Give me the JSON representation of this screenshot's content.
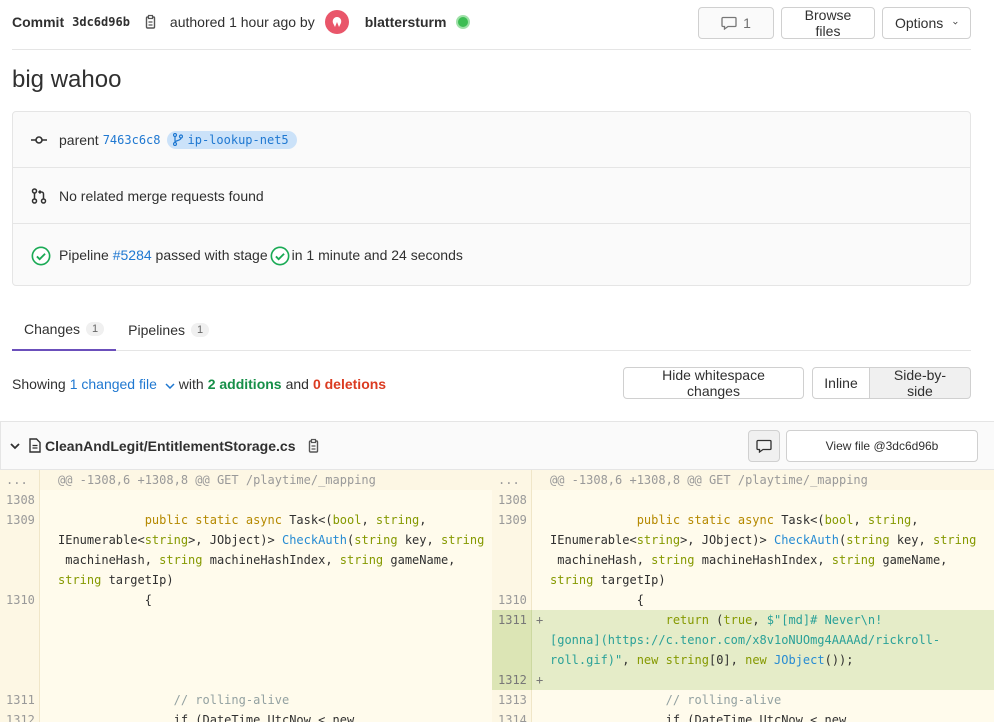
{
  "header": {
    "commit_label": "Commit",
    "sha": "3dc6d96b",
    "authored": "authored 1 hour ago by",
    "author": "blattersturm",
    "comments_count": "1",
    "browse_files": "Browse files",
    "options": "Options"
  },
  "title": "big wahoo",
  "info": {
    "parent_label": "parent",
    "parent_sha": "7463c6c8",
    "branch": "ip-lookup-net5",
    "merge_requests": "No related merge requests found",
    "pipeline_prefix": "Pipeline",
    "pipeline_id": "#5284",
    "pipeline_mid": "passed with stage",
    "pipeline_suffix": "in 1 minute and 24 seconds"
  },
  "tabs": [
    {
      "label": "Changes",
      "count": "1"
    },
    {
      "label": "Pipelines",
      "count": "1"
    }
  ],
  "summary": {
    "showing": "Showing",
    "changed_files": "1 changed file",
    "with": "with",
    "additions": "2 additions",
    "and": "and",
    "deletions": "0 deletions",
    "hide_whitespace": "Hide whitespace changes",
    "inline": "Inline",
    "side_by_side": "Side-by-side"
  },
  "file": {
    "path": "CleanAndLegit/EntitlementStorage.cs",
    "view_file": "View file @3dc6d96b"
  },
  "diff": {
    "hunk": "@@ -1308,6 +1308,8 @@ GET /playtime/_mapping",
    "ellipsis": "...",
    "left": [
      {
        "num": "1308",
        "text": ""
      },
      {
        "num": "1309",
        "text": "            public static async Task<(bool, string,\nIEnumerable<string>, JObject)> CheckAuth(string key, string\n machineHash, string machineHashIndex, string gameName,\nstring targetIp)"
      },
      {
        "num": "1310",
        "text": "            {"
      },
      {
        "num": "",
        "text": ""
      },
      {
        "num": "",
        "text": ""
      },
      {
        "num": "1311",
        "text": "                // rolling-alive"
      },
      {
        "num": "1312",
        "text": "                if (DateTime.UtcNow < new"
      }
    ],
    "right": [
      {
        "num": "1308",
        "text": ""
      },
      {
        "num": "1309",
        "text": "            public static async Task<(bool, string,\nIEnumerable<string>, JObject)> CheckAuth(string key, string\n machineHash, string machineHashIndex, string gameName,\nstring targetIp)"
      },
      {
        "num": "1310",
        "text": "            {"
      },
      {
        "num": "1311",
        "text": "                return (true, $\"[md]# Never\\n!\n[gonna](https://c.tenor.com/x8v1oNUOmg4AAAAd/rickroll-\nroll.gif)\", new string[0], new JObject());"
      },
      {
        "num": "1312",
        "text": ""
      },
      {
        "num": "1313",
        "text": "                // rolling-alive"
      },
      {
        "num": "1314",
        "text": "                if (DateTime.UtcNow < new"
      }
    ]
  },
  "colors": {
    "link": "#1f78d1",
    "additions": "#168f48",
    "deletions": "#db3b21",
    "active_tab": "#6b4fbb",
    "added_line_bg": "#e5ecc8"
  }
}
